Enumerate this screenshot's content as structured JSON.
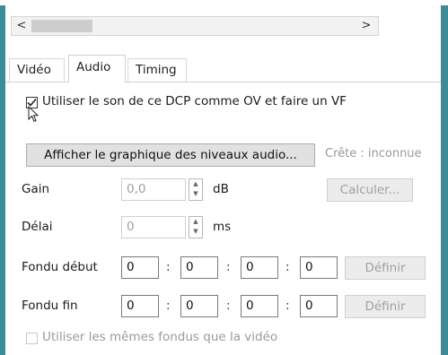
{
  "scrollbar": {
    "left_arrow": "<",
    "right_arrow": ">"
  },
  "tabs": [
    {
      "label": "Vidéo",
      "active": false
    },
    {
      "label": "Audio",
      "active": true
    },
    {
      "label": "Timing",
      "active": false
    }
  ],
  "ov_checkbox": {
    "label": "Utiliser le son de ce DCP comme OV et faire un VF",
    "checked": true
  },
  "audio_graph": {
    "button_label": "Afficher le graphique des niveaux audio...",
    "peak_label": "Crête : inconnue"
  },
  "gain": {
    "label": "Gain",
    "value": "0,0",
    "unit": "dB",
    "calc_button": "Calculer..."
  },
  "delay": {
    "label": "Délai",
    "value": "0",
    "unit": "ms"
  },
  "fade_in": {
    "label": "Fondu début",
    "values": [
      "0",
      "0",
      "0",
      "0"
    ],
    "separator": ":",
    "button": "Définir"
  },
  "fade_out": {
    "label": "Fondu fin",
    "values": [
      "0",
      "0",
      "0",
      "0"
    ],
    "separator": ":",
    "button": "Définir"
  },
  "same_fades": {
    "label": "Utiliser les mêmes fondus que la vidéo",
    "checked": false
  },
  "colors": {
    "accent": "#3b8c97"
  }
}
